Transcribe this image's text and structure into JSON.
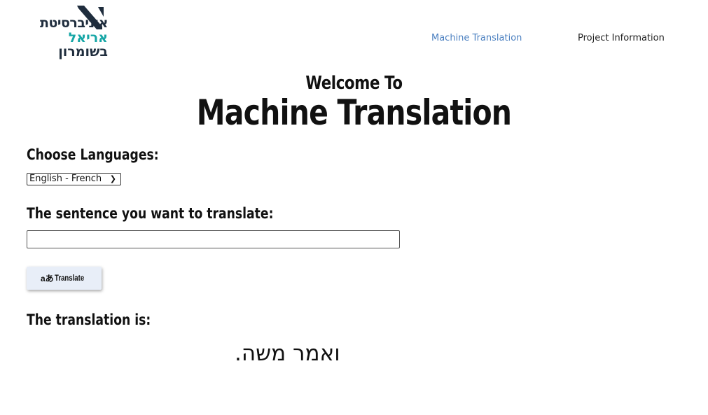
{
  "logo": {
    "line1": "אוניברסיטת",
    "line2": "אריאל",
    "line3": "בשומרון"
  },
  "nav": {
    "machine_translation": "Machine Translation",
    "project_information": "Project Information"
  },
  "hero": {
    "welcome": "Welcome To",
    "title": "Machine Translation"
  },
  "form": {
    "choose_label": "Choose Languages:",
    "language_selected": "English - French",
    "sentence_label": "The sentence you want to translate:",
    "sentence_value": "",
    "translate_icon": "aあ",
    "translate_button": "Translate",
    "result_label": "The translation is:",
    "result_text": "ואמר משה."
  }
}
